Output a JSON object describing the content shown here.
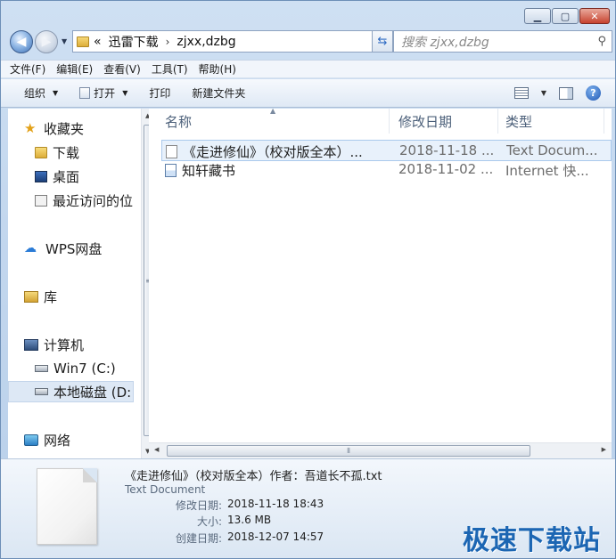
{
  "address": {
    "crumbs": [
      "迅雷下载",
      "zjxx,dzbg"
    ],
    "overflow_glyph": "«",
    "search_placeholder": "搜索 zjxx,dzbg"
  },
  "menu": [
    "文件(F)",
    "编辑(E)",
    "查看(V)",
    "工具(T)",
    "帮助(H)"
  ],
  "commands": {
    "organize": "组织",
    "open": "打开",
    "print": "打印",
    "new_folder": "新建文件夹"
  },
  "nav": {
    "favorites": "收藏夹",
    "downloads": "下载",
    "desktop": "桌面",
    "recent": "最近访问的位",
    "wps": "WPS网盘",
    "library": "库",
    "computer": "计算机",
    "drive_c": "Win7 (C:)",
    "drive_d": "本地磁盘 (D:",
    "network": "网络"
  },
  "columns": {
    "name": "名称",
    "date": "修改日期",
    "type": "类型"
  },
  "files": [
    {
      "name": "《走进修仙》（校对版全本）...",
      "date": "2018-11-18 ...",
      "type": "Text Docum...",
      "icon": "text-file-icon",
      "selected": true
    },
    {
      "name": "知轩藏书",
      "date": "2018-11-02 ...",
      "type": "Internet 快...",
      "icon": "internet-shortcut-icon",
      "selected": false
    }
  ],
  "details": {
    "title": "《走进修仙》（校对版全本）作者：吾道长不孤.txt",
    "type": "Text Document",
    "modified_label": "修改日期:",
    "modified": "2018-11-18 18:43",
    "size_label": "大小:",
    "size": "13.6 MB",
    "created_label": "创建日期:",
    "created": "2018-12-07 14:57"
  },
  "watermark": "极速下载站",
  "colors": {
    "accent": "#1c66b3",
    "selection": "#e8f1fb",
    "frame": "#c3d7ee"
  }
}
